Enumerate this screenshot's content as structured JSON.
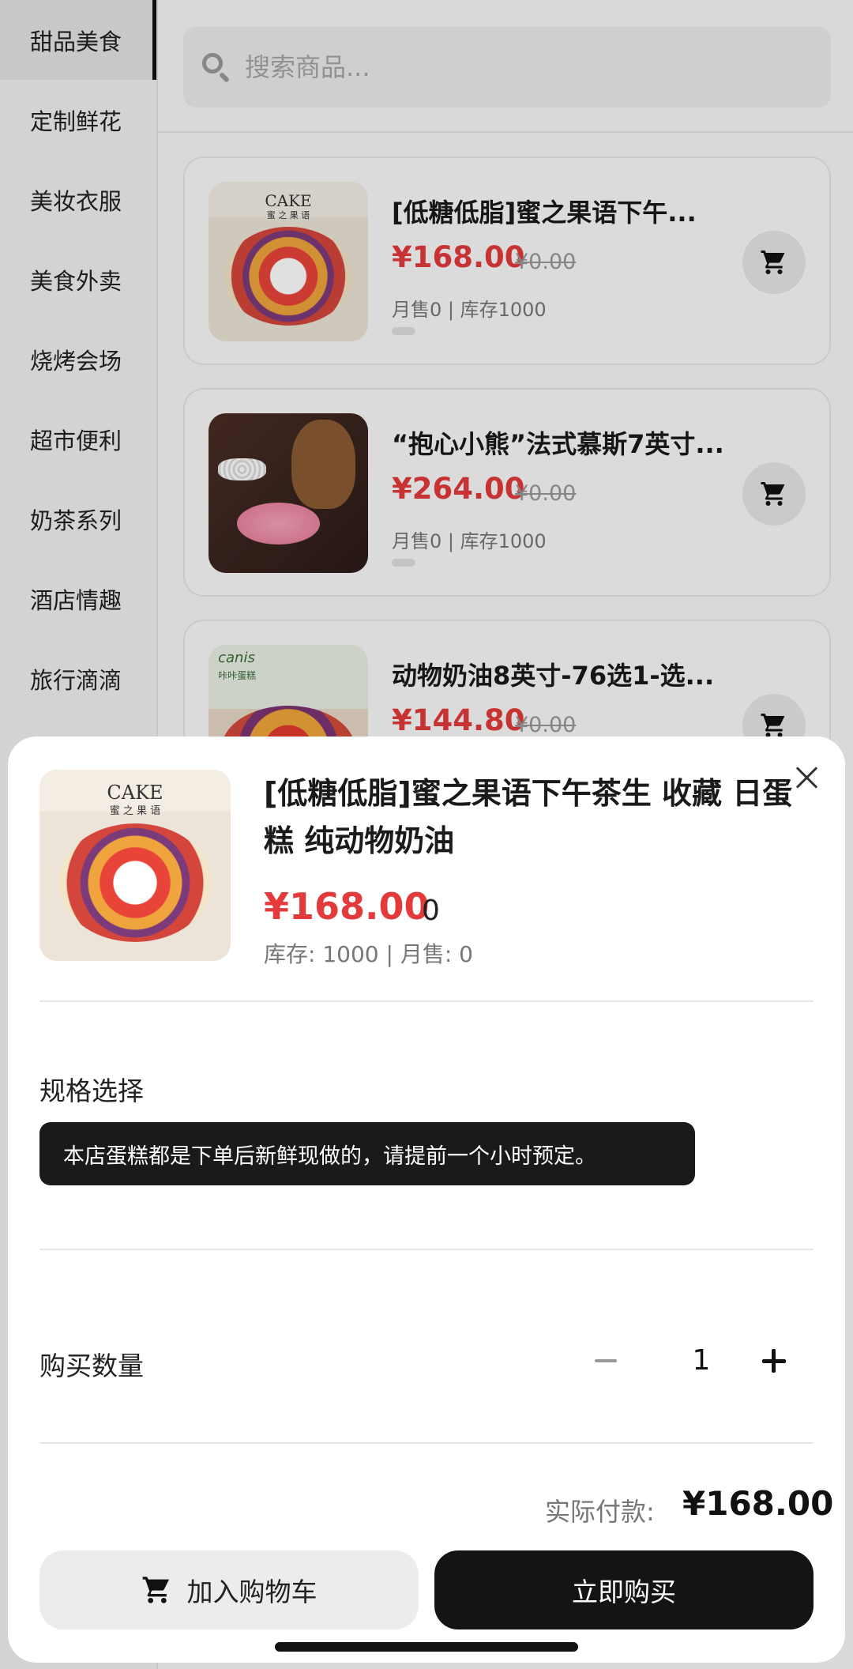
{
  "sidebar": {
    "items": [
      {
        "label": "甜品美食"
      },
      {
        "label": "定制鲜花"
      },
      {
        "label": "美妆衣服"
      },
      {
        "label": "美食外卖"
      },
      {
        "label": "烧烤会场"
      },
      {
        "label": "超市便利"
      },
      {
        "label": "奶茶系列"
      },
      {
        "label": "酒店情趣"
      },
      {
        "label": "旅行滴滴"
      }
    ]
  },
  "search": {
    "placeholder": "搜索商品..."
  },
  "products": [
    {
      "title": "[低糖低脂]蜜之果语下午...",
      "price": "¥168.00",
      "original_price": "¥0.00",
      "meta": "月售0 | 库存1000",
      "image_text": "CAKE",
      "image_subtext": "蜜 之 果 语"
    },
    {
      "title": "“抱心小熊”法式慕斯7英寸...",
      "price": "¥264.00",
      "original_price": "¥0.00",
      "meta": "月售0 | 库存1000"
    },
    {
      "title": "动物奶油8英寸-76选1-选...",
      "price": "¥144.80",
      "original_price": "¥0.00",
      "image_text": "canis",
      "image_subtext": "咔咔蛋糕"
    }
  ],
  "sheet": {
    "title": "[低糖低脂]蜜之果语下午茶生 收藏 日蛋糕 纯动物奶油",
    "price": "¥168.00",
    "original_price": "0",
    "stock": "库存: 1000 | 月售: 0",
    "image_text": "CAKE",
    "image_subtext": "蜜 之 果 语",
    "spec_label": "规格选择",
    "spec_option": "本店蛋糕都是下单后新鲜现做的，请提前一个小时预定。",
    "qty_label": "购买数量",
    "qty": "1",
    "pay_label": "实际付款:",
    "pay_total": "¥168.00",
    "add_cart_label": "加入购物车",
    "buy_label": "立即购买"
  },
  "colors": {
    "accent_price": "#e33b3b",
    "primary_button": "#141414"
  },
  "icons": {
    "search": "search-icon",
    "cart": "cart-icon",
    "close": "close-icon",
    "minus": "minus-icon",
    "plus": "plus-icon"
  }
}
